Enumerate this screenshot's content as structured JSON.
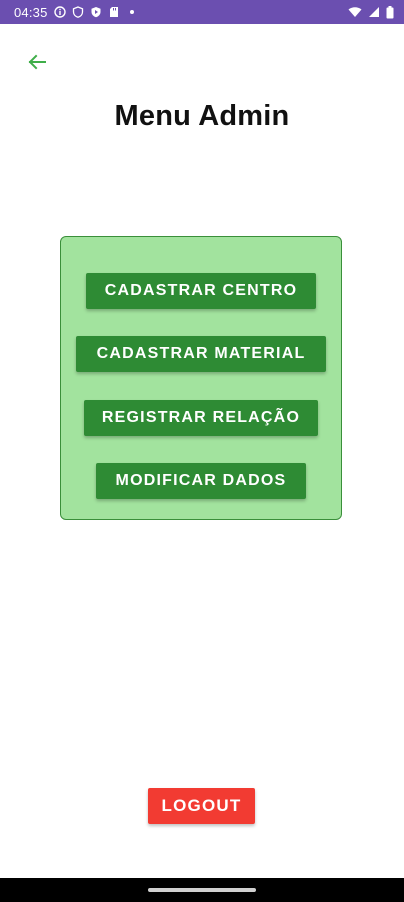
{
  "status_bar": {
    "time": "04:35",
    "icons_left": [
      "info-icon",
      "shield-icon",
      "play-protect-icon",
      "sd-card-icon",
      "dot-icon"
    ],
    "icons_right": [
      "wifi-icon",
      "signal-icon",
      "battery-icon"
    ],
    "background": "#6b4fb0"
  },
  "header": {
    "back_icon": "arrow-left-icon",
    "title": "Menu Admin"
  },
  "menu": {
    "background": "#a2e39e",
    "button_color": "#2e8b34",
    "buttons": [
      {
        "label": "CADASTRAR CENTRO"
      },
      {
        "label": "CADASTRAR MATERIAL"
      },
      {
        "label": "REGISTRAR RELAÇÃO"
      },
      {
        "label": "MODIFICAR DADOS"
      }
    ]
  },
  "logout": {
    "label": "LOGOUT",
    "color": "#f23b32"
  }
}
